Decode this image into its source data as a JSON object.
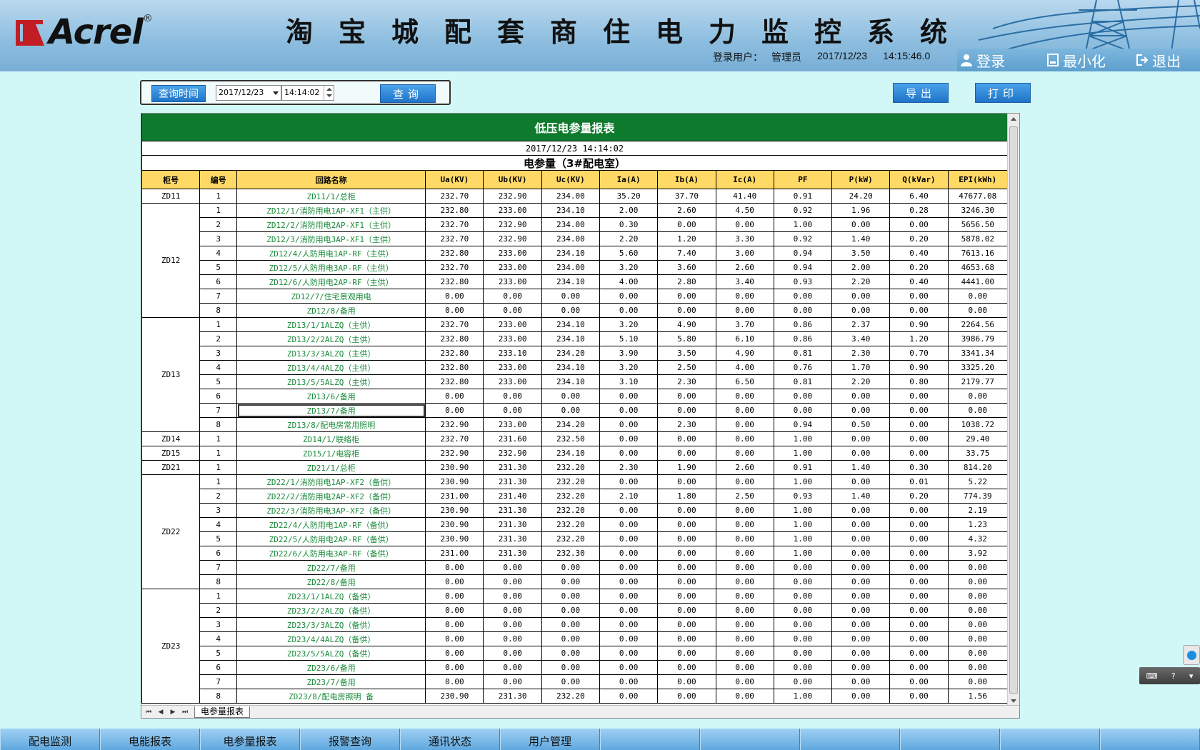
{
  "header": {
    "logo_text": "Acrel",
    "logo_reg": "®",
    "title": "淘宝城配套商住电力监控系统",
    "user_label": "登录用户：",
    "user_name": "管理员",
    "date": "2017/12/23",
    "time": "14:15:46.0",
    "buttons": [
      {
        "label": "登录",
        "icon": "user-icon"
      },
      {
        "label": "最小化",
        "icon": "minimize-icon"
      },
      {
        "label": "退出",
        "icon": "exit-icon"
      }
    ]
  },
  "query": {
    "label": "查询时间",
    "date": "2017/12/23",
    "time": "14:14:02",
    "search_button": "查询",
    "export_button": "导出",
    "print_button": "打印"
  },
  "report": {
    "title": "低压电参量报表",
    "datetime": "2017/12/23 14:14:02",
    "subtitle": "电参量（3#配电室）",
    "headers": [
      "柜号",
      "编号",
      "回路名称",
      "Ua(KV)",
      "Ub(KV)",
      "Uc(KV)",
      "Ia(A)",
      "Ib(A)",
      "Ic(A)",
      "PF",
      "P(kW)",
      "Q(kVar)",
      "EPI(kWh)"
    ],
    "groups": [
      {
        "cabinet": "ZD11",
        "rows": [
          [
            "1",
            "ZD11/1/总柜",
            "232.70",
            "232.90",
            "234.00",
            "35.20",
            "37.70",
            "41.40",
            "0.91",
            "24.20",
            "6.40",
            "47677.08"
          ]
        ]
      },
      {
        "cabinet": "ZD12",
        "rows": [
          [
            "1",
            "ZD12/1/消防用电1AP-XF1（主供）",
            "232.80",
            "233.00",
            "234.10",
            "2.00",
            "2.60",
            "4.50",
            "0.92",
            "1.96",
            "0.28",
            "3246.30"
          ],
          [
            "2",
            "ZD12/2/消防用电2AP-XF1（主供）",
            "232.70",
            "232.90",
            "234.00",
            "0.30",
            "0.00",
            "0.00",
            "1.00",
            "0.00",
            "0.00",
            "5656.50"
          ],
          [
            "3",
            "ZD12/3/消防用电3AP-XF1（主供）",
            "232.70",
            "232.90",
            "234.00",
            "2.20",
            "1.20",
            "3.30",
            "0.92",
            "1.40",
            "0.20",
            "5878.02"
          ],
          [
            "4",
            "ZD12/4/人防用电1AP-RF（主供）",
            "232.80",
            "233.00",
            "234.10",
            "5.60",
            "7.40",
            "3.00",
            "0.94",
            "3.50",
            "0.40",
            "7613.16"
          ],
          [
            "5",
            "ZD12/5/人防用电3AP-RF（主供）",
            "232.70",
            "233.00",
            "234.00",
            "3.20",
            "3.60",
            "2.60",
            "0.94",
            "2.00",
            "0.20",
            "4653.68"
          ],
          [
            "6",
            "ZD12/6/人防用电2AP-RF（主供）",
            "232.80",
            "233.00",
            "234.10",
            "4.00",
            "2.80",
            "3.40",
            "0.93",
            "2.20",
            "0.40",
            "4441.00"
          ],
          [
            "7",
            "ZD12/7/住宅景观用电",
            "0.00",
            "0.00",
            "0.00",
            "0.00",
            "0.00",
            "0.00",
            "0.00",
            "0.00",
            "0.00",
            "0.00"
          ],
          [
            "8",
            "ZD12/8/备用",
            "0.00",
            "0.00",
            "0.00",
            "0.00",
            "0.00",
            "0.00",
            "0.00",
            "0.00",
            "0.00",
            "0.00"
          ]
        ]
      },
      {
        "cabinet": "ZD13",
        "rows": [
          [
            "1",
            "ZD13/1/1ALZQ（主供）",
            "232.70",
            "233.00",
            "234.10",
            "3.20",
            "4.90",
            "3.70",
            "0.86",
            "2.37",
            "0.90",
            "2264.56"
          ],
          [
            "2",
            "ZD13/2/2ALZQ（主供）",
            "232.80",
            "233.00",
            "234.10",
            "5.10",
            "5.80",
            "6.10",
            "0.86",
            "3.40",
            "1.20",
            "3986.79"
          ],
          [
            "3",
            "ZD13/3/3ALZQ（主供）",
            "232.80",
            "233.10",
            "234.20",
            "3.90",
            "3.50",
            "4.90",
            "0.81",
            "2.30",
            "0.70",
            "3341.34"
          ],
          [
            "4",
            "ZD13/4/4ALZQ（主供）",
            "232.80",
            "233.00",
            "234.10",
            "3.20",
            "2.50",
            "4.00",
            "0.76",
            "1.70",
            "0.90",
            "3325.20"
          ],
          [
            "5",
            "ZD13/5/5ALZQ（主供）",
            "232.80",
            "233.00",
            "234.10",
            "3.10",
            "2.30",
            "6.50",
            "0.81",
            "2.20",
            "0.80",
            "2179.77"
          ],
          [
            "6",
            "ZD13/6/备用",
            "0.00",
            "0.00",
            "0.00",
            "0.00",
            "0.00",
            "0.00",
            "0.00",
            "0.00",
            "0.00",
            "0.00"
          ],
          [
            "7",
            "ZD13/7/备用",
            "0.00",
            "0.00",
            "0.00",
            "0.00",
            "0.00",
            "0.00",
            "0.00",
            "0.00",
            "0.00",
            "0.00"
          ],
          [
            "8",
            "ZD13/8/配电房常用照明",
            "232.90",
            "233.00",
            "234.20",
            "0.00",
            "2.30",
            "0.00",
            "0.94",
            "0.50",
            "0.00",
            "1038.72"
          ]
        ]
      },
      {
        "cabinet": "ZD14",
        "rows": [
          [
            "1",
            "ZD14/1/联络柜",
            "232.70",
            "231.60",
            "232.50",
            "0.00",
            "0.00",
            "0.00",
            "1.00",
            "0.00",
            "0.00",
            "29.40"
          ]
        ]
      },
      {
        "cabinet": "ZD15",
        "rows": [
          [
            "1",
            "ZD15/1/电容柜",
            "232.90",
            "232.90",
            "234.10",
            "0.00",
            "0.00",
            "0.00",
            "1.00",
            "0.00",
            "0.00",
            "33.75"
          ]
        ]
      },
      {
        "cabinet": "ZD21",
        "rows": [
          [
            "1",
            "ZD21/1/总柜",
            "230.90",
            "231.30",
            "232.20",
            "2.30",
            "1.90",
            "2.60",
            "0.91",
            "1.40",
            "0.30",
            "814.20"
          ]
        ]
      },
      {
        "cabinet": "ZD22",
        "rows": [
          [
            "1",
            "ZD22/1/消防用电1AP-XF2（备供）",
            "230.90",
            "231.30",
            "232.20",
            "0.00",
            "0.00",
            "0.00",
            "1.00",
            "0.00",
            "0.01",
            "5.22"
          ],
          [
            "2",
            "ZD22/2/消防用电2AP-XF2（备供）",
            "231.00",
            "231.40",
            "232.20",
            "2.10",
            "1.80",
            "2.50",
            "0.93",
            "1.40",
            "0.20",
            "774.39"
          ],
          [
            "3",
            "ZD22/3/消防用电3AP-XF2（备供）",
            "230.90",
            "231.30",
            "232.20",
            "0.00",
            "0.00",
            "0.00",
            "1.00",
            "0.00",
            "0.00",
            "2.19"
          ],
          [
            "4",
            "ZD22/4/人防用电1AP-RF（备供）",
            "230.90",
            "231.30",
            "232.20",
            "0.00",
            "0.00",
            "0.00",
            "1.00",
            "0.00",
            "0.00",
            "1.23"
          ],
          [
            "5",
            "ZD22/5/人防用电2AP-RF（备供）",
            "230.90",
            "231.30",
            "232.20",
            "0.00",
            "0.00",
            "0.00",
            "1.00",
            "0.00",
            "0.00",
            "4.32"
          ],
          [
            "6",
            "ZD22/6/人防用电3AP-RF（备供）",
            "231.00",
            "231.30",
            "232.30",
            "0.00",
            "0.00",
            "0.00",
            "1.00",
            "0.00",
            "0.00",
            "3.92"
          ],
          [
            "7",
            "ZD22/7/备用",
            "0.00",
            "0.00",
            "0.00",
            "0.00",
            "0.00",
            "0.00",
            "0.00",
            "0.00",
            "0.00",
            "0.00"
          ],
          [
            "8",
            "ZD22/8/备用",
            "0.00",
            "0.00",
            "0.00",
            "0.00",
            "0.00",
            "0.00",
            "0.00",
            "0.00",
            "0.00",
            "0.00"
          ]
        ]
      },
      {
        "cabinet": "ZD23",
        "rows": [
          [
            "1",
            "ZD23/1/1ALZQ（备供）",
            "0.00",
            "0.00",
            "0.00",
            "0.00",
            "0.00",
            "0.00",
            "0.00",
            "0.00",
            "0.00",
            "0.00"
          ],
          [
            "2",
            "ZD23/2/2ALZQ（备供）",
            "0.00",
            "0.00",
            "0.00",
            "0.00",
            "0.00",
            "0.00",
            "0.00",
            "0.00",
            "0.00",
            "0.00"
          ],
          [
            "3",
            "ZD23/3/3ALZQ（备供）",
            "0.00",
            "0.00",
            "0.00",
            "0.00",
            "0.00",
            "0.00",
            "0.00",
            "0.00",
            "0.00",
            "0.00"
          ],
          [
            "4",
            "ZD23/4/4ALZQ（备供）",
            "0.00",
            "0.00",
            "0.00",
            "0.00",
            "0.00",
            "0.00",
            "0.00",
            "0.00",
            "0.00",
            "0.00"
          ],
          [
            "5",
            "ZD23/5/5ALZQ（备供）",
            "0.00",
            "0.00",
            "0.00",
            "0.00",
            "0.00",
            "0.00",
            "0.00",
            "0.00",
            "0.00",
            "0.00"
          ],
          [
            "6",
            "ZD23/6/备用",
            "0.00",
            "0.00",
            "0.00",
            "0.00",
            "0.00",
            "0.00",
            "0.00",
            "0.00",
            "0.00",
            "0.00"
          ],
          [
            "7",
            "ZD23/7/备用",
            "0.00",
            "0.00",
            "0.00",
            "0.00",
            "0.00",
            "0.00",
            "0.00",
            "0.00",
            "0.00",
            "0.00"
          ],
          [
            "8",
            "ZD23/8/配电房照明 备",
            "230.90",
            "231.30",
            "232.20",
            "0.00",
            "0.00",
            "0.00",
            "1.00",
            "0.00",
            "0.00",
            "1.56"
          ]
        ]
      }
    ],
    "sheet_tab": "电参量报表"
  },
  "bottom_nav": [
    "配电监测",
    "电能报表",
    "电参量报表",
    "报警查询",
    "通讯状态",
    "用户管理",
    "",
    "",
    "",
    "",
    "",
    ""
  ],
  "colors": {
    "header_bg": "#8fbfe0",
    "page_bg": "#d2f7f7",
    "report_title_bg": "#0e7a2d",
    "table_header_bg": "#ffd966",
    "circuit_name_color": "#1a8a3a",
    "button_blue": "#1f74c8"
  }
}
